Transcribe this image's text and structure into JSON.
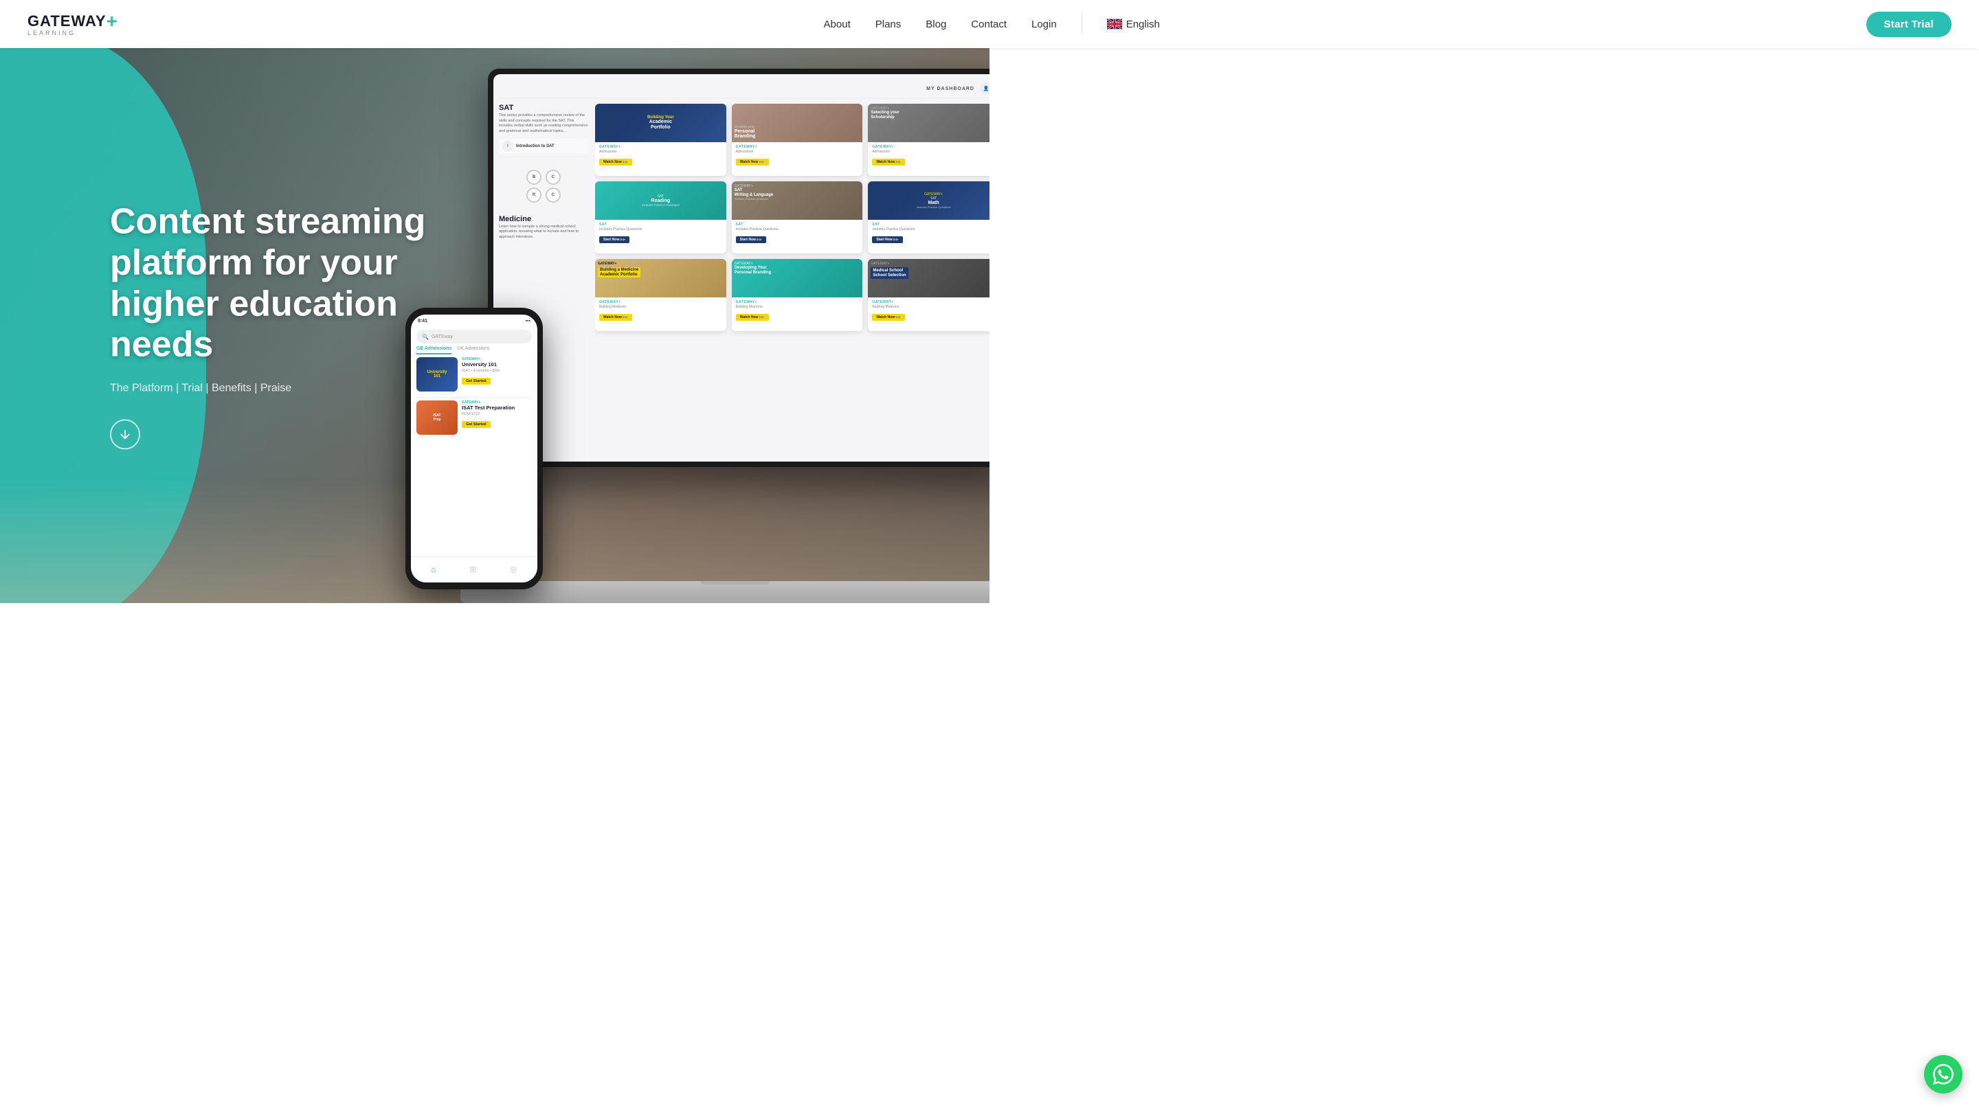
{
  "header": {
    "logo_text": "GATEWAY",
    "logo_plus": "+",
    "logo_sub": "LEARNING",
    "nav_items": [
      {
        "label": "About",
        "href": "#"
      },
      {
        "label": "Plans",
        "href": "#"
      },
      {
        "label": "Blog",
        "href": "#"
      },
      {
        "label": "Contact",
        "href": "#"
      },
      {
        "label": "Login",
        "href": "#"
      }
    ],
    "language": "English",
    "cta_label": "Start Trial"
  },
  "hero": {
    "title": "Content streaming platform for your higher education needs",
    "subtitle_parts": [
      "The Platform",
      "Trial",
      "Benefits",
      "Praise"
    ],
    "subtitle_separator": " | "
  },
  "platform_ui": {
    "dashboard_label": "MY DASHBOARD",
    "sections": [
      {
        "label": "SAT",
        "description": "This series provides a comprehensive review of the skills and concepts required for the SAT.",
        "subsections": [
          "Introduction to SAT",
          "SAT Reading",
          "SAT Writing & Language",
          "SAT Math"
        ]
      },
      {
        "label": "Medicine",
        "description": "Learn how to compile a strong medical school application, knowing what to include and how to approach interviews."
      }
    ],
    "cards": [
      {
        "title": "Building Your Academic Portfolio",
        "badge": "GATEWAY+",
        "type": "blue",
        "btn": "Watch Now"
      },
      {
        "title": "Develop your Personal Branding",
        "badge": "GATEWAY+",
        "type": "person",
        "btn": "Watch Now"
      },
      {
        "title": "Selecting your Scholarship",
        "badge": "GATEWAY+",
        "type": "person2",
        "btn": "Watch Now"
      },
      {
        "title": "SAT Reading",
        "badge": "SAT",
        "type": "teal",
        "btn": "Start Now"
      },
      {
        "title": "SAT Writing & Language",
        "badge": "SAT",
        "type": "books",
        "btn": "Start Now"
      },
      {
        "title": "SAT Math",
        "badge": "SAT",
        "type": "blue",
        "btn": "Start Now"
      },
      {
        "title": "Building a Medicine Academic Portfolio",
        "badge": "GATEWAY+",
        "type": "yellow",
        "btn": "Watch Now"
      },
      {
        "title": "Developing Your Personal Branding",
        "badge": "GATEWAY+",
        "type": "teal2",
        "btn": "Watch Now"
      },
      {
        "title": "Medical School Selection",
        "badge": "GATEWAY+",
        "type": "blue2",
        "btn": "Watch Now"
      }
    ]
  },
  "phone_ui": {
    "time": "8:41",
    "search_placeholder": "GATEway",
    "tabs": [
      "GE Admissions",
      "UK Admissions"
    ],
    "courses": [
      {
        "name": "University 101",
        "badge": "GATEWAY+",
        "meta": "ISAT • 4 months • 80hr",
        "type": "blue"
      },
      {
        "name": "ISAT Test Preparation",
        "badge": "GATEWAY+",
        "meta": "FCM-1210",
        "type": "people"
      }
    ],
    "btn_label": "Get Started"
  },
  "whatsapp": {
    "aria_label": "Contact via WhatsApp"
  }
}
